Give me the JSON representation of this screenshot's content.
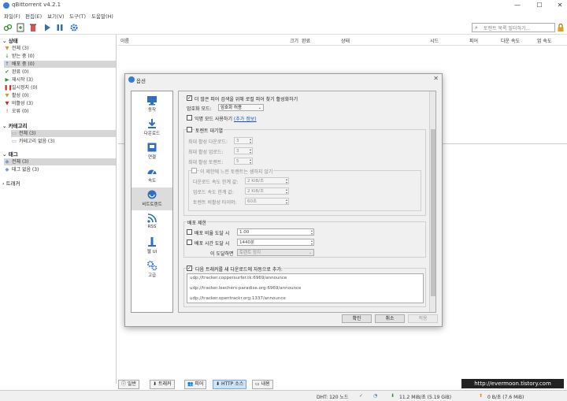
{
  "window": {
    "title": "qBittorrent v4.2.1",
    "controls": [
      "—",
      "☐",
      "✕"
    ]
  },
  "menu": [
    "파일(F)",
    "편집(E)",
    "보기(V)",
    "도구(T)",
    "도움말(H)"
  ],
  "toolbar": {
    "icons": [
      "add-link-icon",
      "add-file-icon",
      "delete-icon",
      "resume-icon",
      "pause-icon",
      "options-icon"
    ],
    "search_placeholder": "토렌트 목록 필터하기..."
  },
  "sidebar": {
    "status_header": "상태",
    "status_items": [
      {
        "label": "전체 (3)",
        "icon": "filter-icon",
        "color": "#c79a2b"
      },
      {
        "label": "받는 중 (0)",
        "icon": "download-arrow-icon",
        "color": "#2f8f2f"
      },
      {
        "label": "배포 중 (0)",
        "icon": "upload-arrow-icon",
        "color": "#2f6fbf"
      },
      {
        "label": "완료 (0)",
        "icon": "check-icon",
        "color": "#2f8f2f"
      },
      {
        "label": "재시작 (3)",
        "icon": "play-icon",
        "color": "#2f8f2f"
      },
      {
        "label": "일시정지 (0)",
        "icon": "pause-icon",
        "color": "#c02f2f"
      },
      {
        "label": "활성 (0)",
        "icon": "filter-icon",
        "color": "#c79a2b"
      },
      {
        "label": "비활성 (3)",
        "icon": "filter-icon",
        "color": "#c02f2f"
      },
      {
        "label": "오류 (0)",
        "icon": "error-icon",
        "color": "#c02f2f"
      }
    ],
    "category_header": "카테고리",
    "category_items": [
      "전체 (3)",
      "카테고리 없음 (3)"
    ],
    "tag_header": "태그",
    "tag_items": [
      "전체 (3)",
      "태그 없음 (3)"
    ],
    "tracker_header": "트래커"
  },
  "list_columns": [
    "이름",
    "크기",
    "완료",
    "상태",
    "시드",
    "피어",
    "다운 속도",
    "업 속도"
  ],
  "bottom_tabs": [
    "일반",
    "트래커",
    "피어",
    "HTTP 소스",
    "내용"
  ],
  "status_bar": {
    "dht": "DHT: 120 노드",
    "download": "11.2 MiB/초 (5.19 GiB)",
    "upload": "0 B/초 (7.6 MiB)"
  },
  "watermark": "http://evermoon.tistory.com",
  "dialog": {
    "title": "옵션",
    "categories": [
      {
        "label": "동작",
        "icon": "behavior-icon"
      },
      {
        "label": "다운로드",
        "icon": "download-icon"
      },
      {
        "label": "연결",
        "icon": "connection-icon"
      },
      {
        "label": "속도",
        "icon": "speed-icon"
      },
      {
        "label": "비트토렌트",
        "icon": "bittorrent-icon"
      },
      {
        "label": "RSS",
        "icon": "rss-icon"
      },
      {
        "label": "웹 UI",
        "icon": "webui-icon"
      },
      {
        "label": "고급",
        "icon": "advanced-icon"
      }
    ],
    "selected_category": "비트토렌트",
    "lpd_label": "더 많은 피어 검색을 위해 로컬 피어 찾기 활성화하기",
    "encryption_label": "암호화 모드:",
    "encryption_value": "암호화 허용",
    "anonymous_label": "익명 모드 사용하기",
    "more_info": "(추가 정보)",
    "queue_label": "토렌트 대기열",
    "max_active_downloads_label": "최대 활성 다운로드:",
    "max_active_downloads": "3",
    "max_active_uploads_label": "최대 활성 업로드:",
    "max_active_uploads": "3",
    "max_active_torrents_label": "최대 활성 토렌트:",
    "max_active_torrents": "5",
    "slow_torrents_label": "이 제한에 느린 토렌트는 셈하지 않기",
    "dl_rate_threshold_label": "다운로드 속도 한계 값:",
    "dl_rate_threshold": "2 KiB/초",
    "ul_rate_threshold_label": "업로드 속도 한계 값:",
    "ul_rate_threshold": "2 KiB/초",
    "inactivity_timer_label": "토렌트 비활성 타이머:",
    "inactivity_timer": "60초",
    "seeding_limits_label": "배포 제한",
    "ratio_label": "배포 비율 도달 시",
    "ratio_value": "1.00",
    "seed_time_label": "배포 시간 도달 시",
    "seed_time_value": "1440분",
    "then_label": "이 도달하면",
    "then_value": "토렌트 정지",
    "add_trackers_label": "다음 트래커를 새 다운로드에 자동으로 추가:",
    "trackers": [
      "udp://tracker.coppersurfer.tk:6969/announce",
      "udp://tracker.leechers-paradise.org:6969/announce",
      "udp://tracker.opentrackr.org:1337/announce"
    ],
    "ok_label": "확인",
    "cancel_label": "취소",
    "apply_label": "적용"
  }
}
